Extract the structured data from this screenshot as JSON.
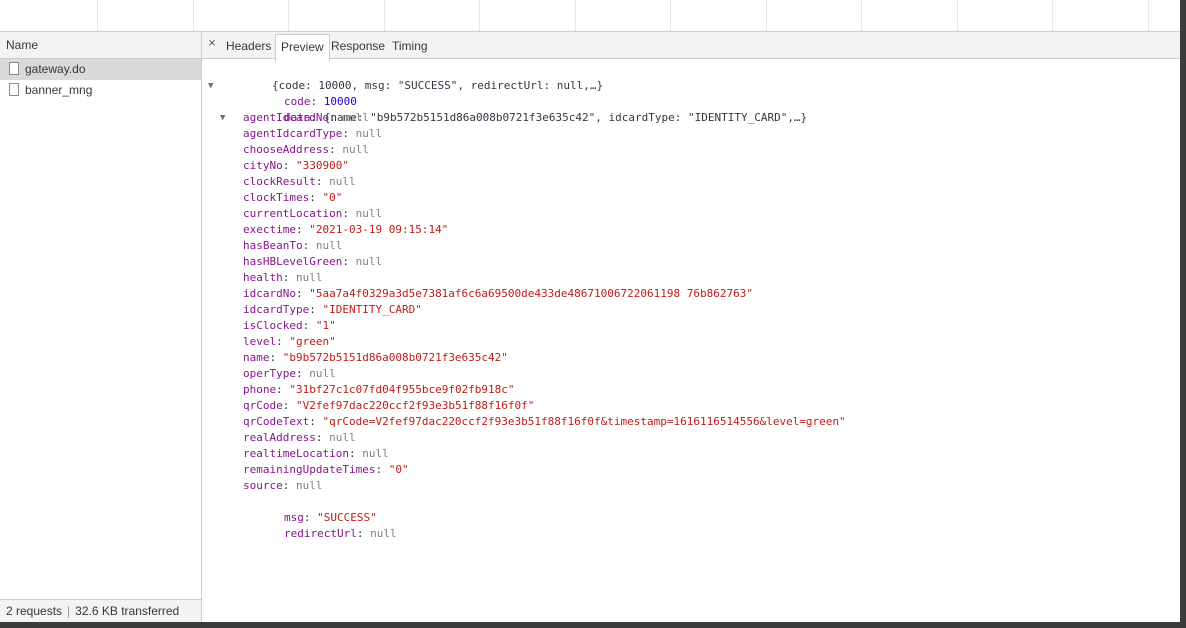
{
  "list": {
    "header": "Name",
    "requests": [
      {
        "name": "gateway.do",
        "selected": true
      },
      {
        "name": "banner_mng",
        "selected": false
      }
    ],
    "status_requests": "2 requests",
    "status_separator": "|",
    "status_transferred": "32.6 KB transferred"
  },
  "detail": {
    "close_symbol": "×",
    "tabs": [
      "Headers",
      "Preview",
      "Response",
      "Timing"
    ],
    "active_tab": "Preview"
  },
  "preview": {
    "root_summary": "{code: 10000, msg: \"SUCCESS\", redirectUrl: null,…}",
    "code_key": "code",
    "code_value": "10000",
    "data_key": "data",
    "data_summary": "{name: \"b9b572b5151d86a008b0721f3e635c42\", idcardType: \"IDENTITY_CARD\",…}",
    "data_fields": [
      {
        "key": "agentIdcardNo",
        "value": "null",
        "type": "null"
      },
      {
        "key": "agentIdcardType",
        "value": "null",
        "type": "null"
      },
      {
        "key": "chooseAddress",
        "value": "null",
        "type": "null"
      },
      {
        "key": "cityNo",
        "value": "\"330900\"",
        "type": "string"
      },
      {
        "key": "clockResult",
        "value": "null",
        "type": "null"
      },
      {
        "key": "clockTimes",
        "value": "\"0\"",
        "type": "string"
      },
      {
        "key": "currentLocation",
        "value": "null",
        "type": "null"
      },
      {
        "key": "exectime",
        "value": "\"2021-03-19 09:15:14\"",
        "type": "string"
      },
      {
        "key": "hasBeanTo",
        "value": "null",
        "type": "null"
      },
      {
        "key": "hasHBLevelGreen",
        "value": "null",
        "type": "null"
      },
      {
        "key": "health",
        "value": "null",
        "type": "null"
      },
      {
        "key": "idcardNo",
        "value": "\"5aa7a4f0329a3d5e7381af6c6a69500de433de48671006722061198 76b862763\"",
        "type": "string"
      },
      {
        "key": "idcardType",
        "value": "\"IDENTITY_CARD\"",
        "type": "string"
      },
      {
        "key": "isClocked",
        "value": "\"1\"",
        "type": "string"
      },
      {
        "key": "level",
        "value": "\"green\"",
        "type": "string"
      },
      {
        "key": "name",
        "value": "\"b9b572b5151d86a008b0721f3e635c42\"",
        "type": "string"
      },
      {
        "key": "operType",
        "value": "null",
        "type": "null"
      },
      {
        "key": "phone",
        "value": "\"31bf27c1c07fd04f955bce9f02fb918c\"",
        "type": "string"
      },
      {
        "key": "qrCode",
        "value": "\"V2fef97dac220ccf2f93e3b51f88f16f0f\"",
        "type": "string"
      },
      {
        "key": "qrCodeText",
        "value": "\"qrCode=V2fef97dac220ccf2f93e3b51f88f16f0f&timestamp=1616116514556&level=green\"",
        "type": "string"
      },
      {
        "key": "realAddress",
        "value": "null",
        "type": "null"
      },
      {
        "key": "realtimeLocation",
        "value": "null",
        "type": "null"
      },
      {
        "key": "remainingUpdateTimes",
        "value": "\"0\"",
        "type": "string"
      },
      {
        "key": "source",
        "value": "null",
        "type": "null"
      }
    ],
    "msg_key": "msg",
    "msg_value": "\"SUCCESS\"",
    "redirect_key": "redirectUrl",
    "redirect_value": "null"
  },
  "colors": {
    "key": "#881391",
    "string": "#c41a16",
    "number": "#1c00cf",
    "null": "#808080",
    "selected_row": "#dadada"
  }
}
